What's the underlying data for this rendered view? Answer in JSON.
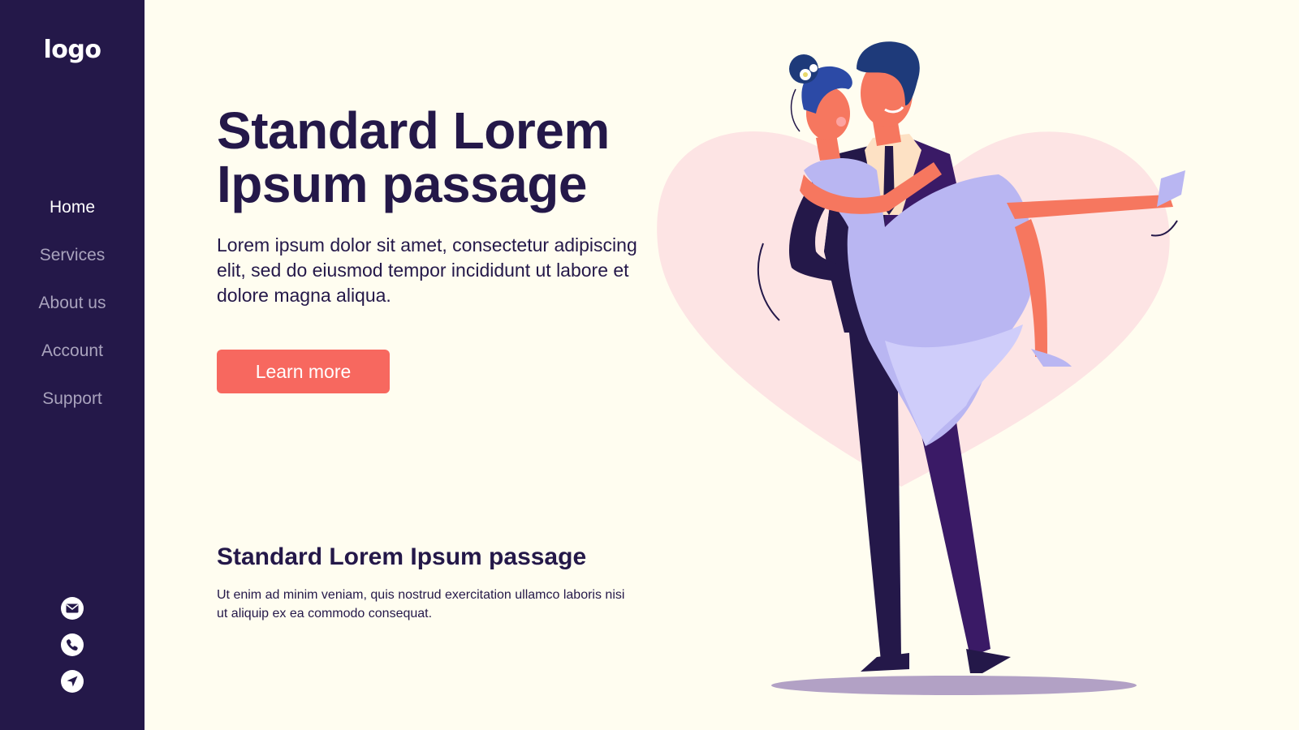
{
  "sidebar": {
    "logo": "logo",
    "nav": [
      "Home",
      "Services",
      "About us",
      "Account",
      "Support"
    ],
    "active_index": 0,
    "contact_icons": [
      "mail-icon",
      "phone-icon",
      "navigation-arrow-icon"
    ]
  },
  "hero": {
    "title": "Standard Lorem Ipsum passage",
    "text": "Lorem ipsum dolor sit amet, consectetur adipiscing elit, sed do eiusmod tempor incididunt ut labore et dolore magna aliqua.",
    "button": "Learn more"
  },
  "secondary": {
    "title": "Standard Lorem Ipsum passage",
    "text": "Ut enim ad minim veniam, quis nostrud exercitation ullamco laboris nisi ut aliquip ex ea commodo consequat."
  },
  "colors": {
    "sidebar": "#241849",
    "background": "#fffdf0",
    "accent": "#f7685f",
    "heart": "#fde4e4",
    "dress": "#b9b6f2"
  }
}
